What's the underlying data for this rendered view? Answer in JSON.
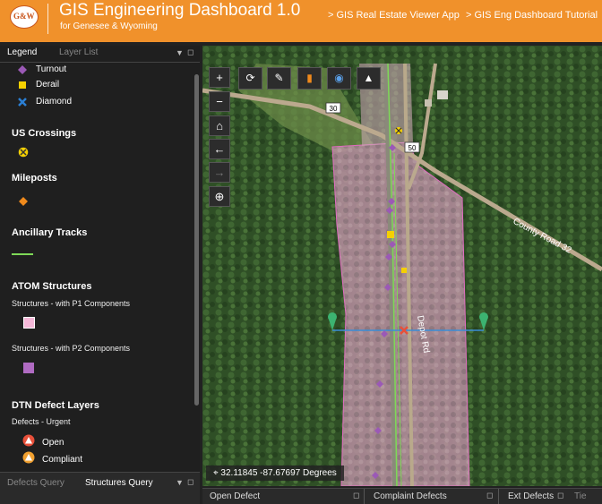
{
  "header": {
    "logo_text": "G&W",
    "title": "GIS Engineering Dashboard 1.0",
    "subtitle": "for Genesee & Wyoming",
    "links": [
      "> GIS Real Estate Viewer App",
      "> GIS Eng Dashboard Tutorial"
    ]
  },
  "left_panel": {
    "tabs": [
      "Legend",
      "Layer List"
    ],
    "legend": {
      "items_top": [
        {
          "label": "Turnout",
          "icon": "purple-diamond-icon"
        },
        {
          "label": "Derail",
          "icon": "yellow-square-icon"
        },
        {
          "label": "Diamond",
          "icon": "blue-x-icon"
        }
      ],
      "us_crossings": "US Crossings",
      "mileposts": "Mileposts",
      "ancillary_tracks": "Ancillary Tracks",
      "atom_structures": "ATOM Structures",
      "structures_p1": "Structures - with P1 Components",
      "structures_p2": "Structures - with P2 Components",
      "dtn_defect_layers": "DTN Defect Layers",
      "defects_urgent": "Defects - Urgent",
      "open": "Open",
      "compliant": "Compliant"
    },
    "colors": {
      "turnout": "#9b59b6",
      "derail": "#f5d000",
      "diamond": "#2b7fd4",
      "milepost": "#f08a1c",
      "ancillary": "#7ed957",
      "p1": "#f5b8d8",
      "p2": "#b06bc2",
      "open": "#e8503a",
      "compliant": "#f0a030"
    }
  },
  "bottom_tabs": {
    "left": [
      "Defects Query",
      "Structures Query"
    ],
    "right": [
      "Open Defect",
      "Complaint Defects",
      "Ext Defects",
      "Tie"
    ]
  },
  "map": {
    "coords": "32.11845 -87.67697 Degrees",
    "road_labels": [
      "County Road 32",
      "Depot Rd"
    ],
    "route_shields": [
      "30",
      "50"
    ],
    "tools": [
      "zoom-in-icon",
      "zoom-out-icon",
      "home-icon",
      "back-icon",
      "forward-icon",
      "locate-icon"
    ],
    "top_tools": [
      "measure-icon",
      "draw-icon",
      "pin-icon",
      "globe-icon",
      "basemap-icon"
    ]
  }
}
